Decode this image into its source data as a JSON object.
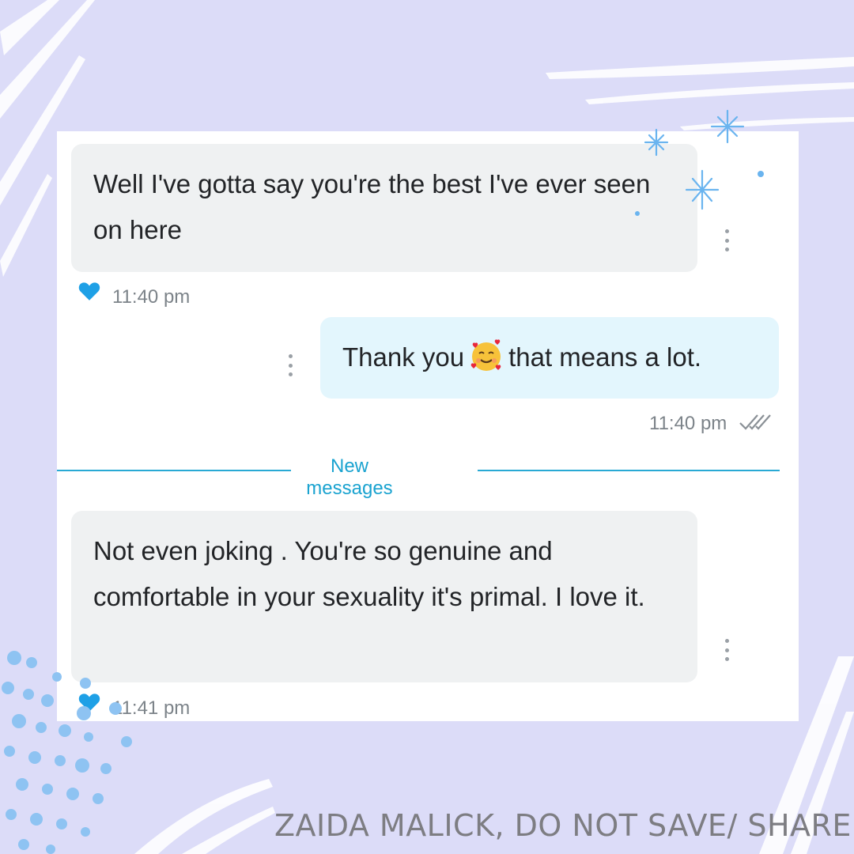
{
  "messages": [
    {
      "direction": "incoming",
      "text": "Well I've gotta say you're the best I've ever seen on here",
      "time": "11:40 pm",
      "liked": true
    },
    {
      "direction": "outgoing",
      "text_before": "Thank you",
      "emoji": "smiling-face-with-hearts",
      "text_after": "that means a lot.",
      "time": "11:40 pm",
      "status": "read"
    },
    {
      "direction": "incoming",
      "text": "Not even joking . You're so genuine and comfortable in your sexuality it's primal. I love it.",
      "time": "11:41 pm",
      "liked": true
    }
  ],
  "divider": {
    "label": "New messages"
  },
  "watermark": "ZAIDA MALICK, DO NOT SAVE/ SHARE",
  "colors": {
    "background": "#dcdcf8",
    "incoming_bubble": "#eff1f2",
    "outgoing_bubble": "#e3f6fd",
    "accent": "#1aa3d0",
    "heart": "#1ea0e6"
  },
  "icons": {
    "like": "heart-icon",
    "more": "more-vertical-icon",
    "read": "double-check-icon"
  }
}
